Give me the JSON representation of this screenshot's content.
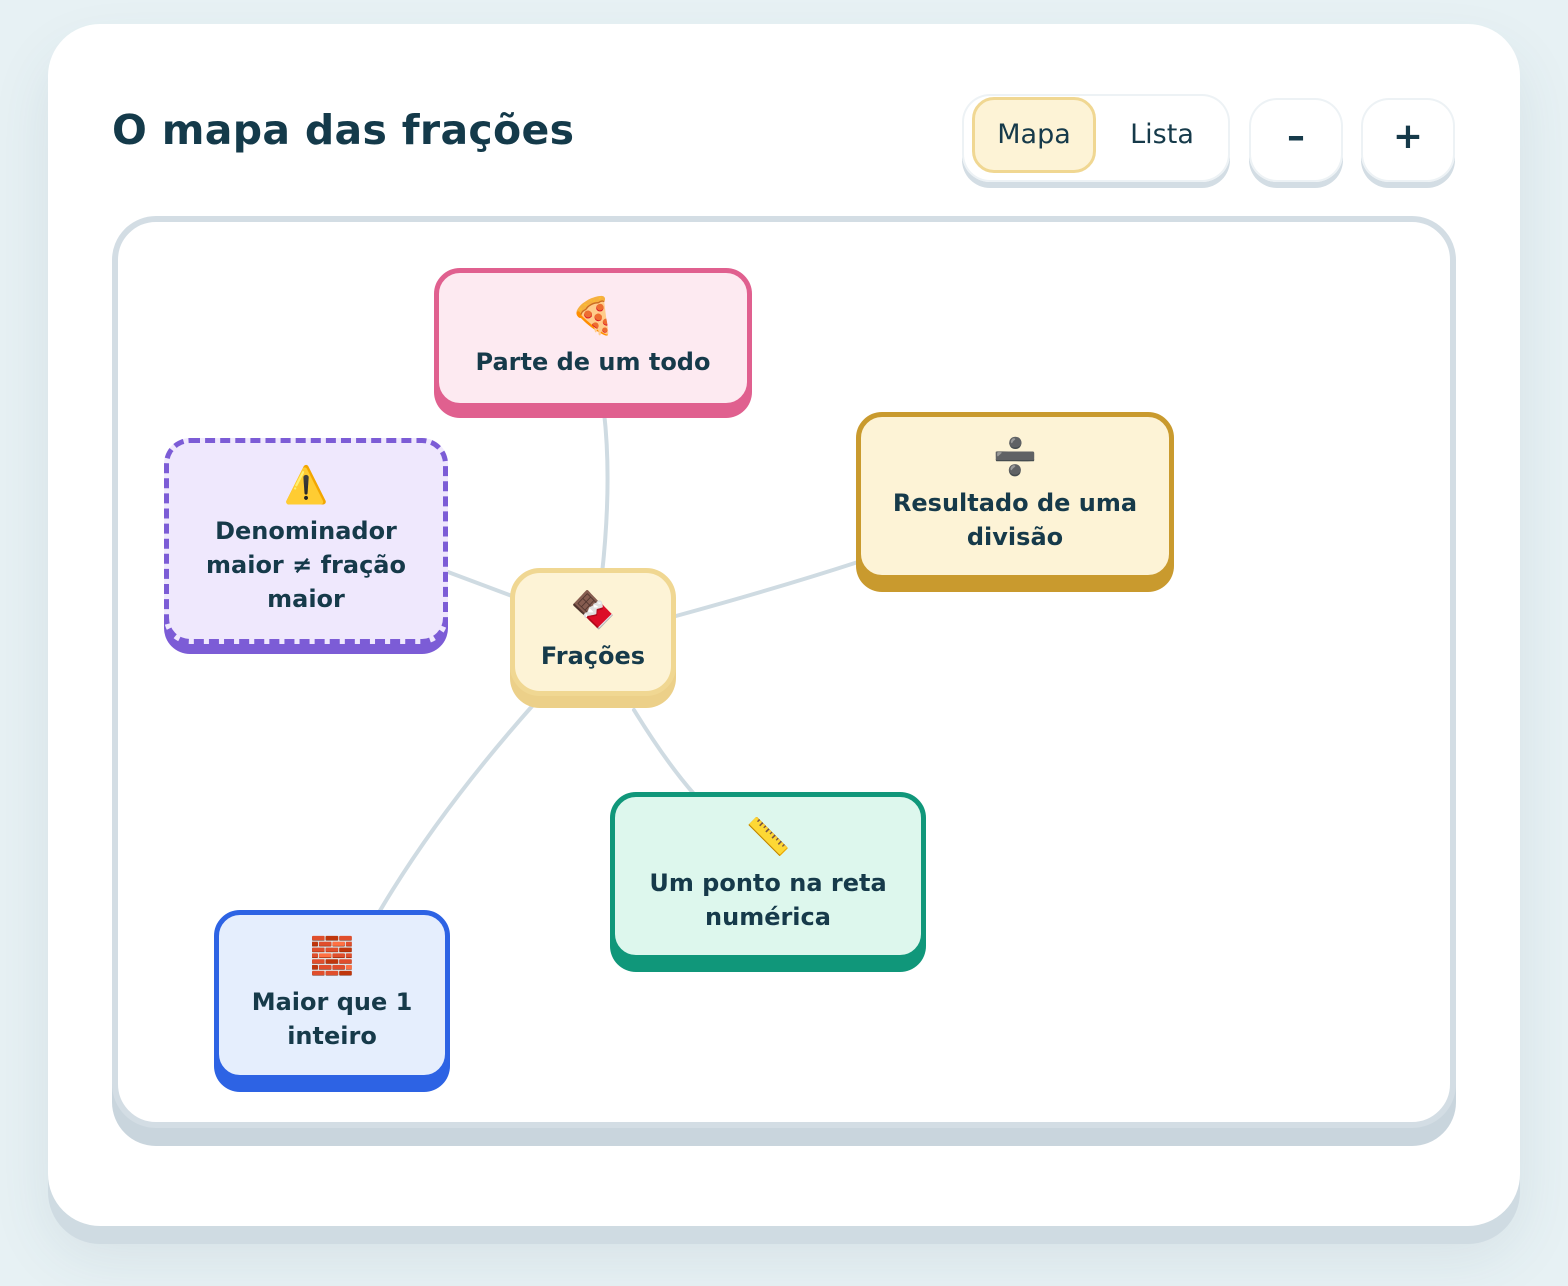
{
  "header": {
    "title": "O mapa das frações"
  },
  "view_toggle": {
    "map_label": "Mapa",
    "list_label": "Lista",
    "selected": "Mapa"
  },
  "zoom": {
    "out_label": "–",
    "in_label": "+"
  },
  "map": {
    "center": {
      "emoji": "🍫",
      "label": "Frações"
    },
    "nodes": {
      "parte": {
        "emoji": "🍕",
        "label": "Parte de um todo"
      },
      "resultado": {
        "emoji": "➗",
        "label": "Resultado de uma divisão"
      },
      "denominador": {
        "emoji": "⚠️",
        "label": "Denominador maior ≠ fração maior"
      },
      "ponto": {
        "emoji": "📏",
        "label": "Um ponto na reta numérica"
      },
      "maior": {
        "emoji": "🧱",
        "label": "Maior que 1 inteiro"
      }
    },
    "link_color": "#cfdbe2"
  },
  "colors": {
    "pink": "#e0608f",
    "gold": "#c99a2e",
    "purple": "#7c5cd6",
    "teal": "#10977a",
    "blue": "#2d63e4",
    "center_border": "#f0d792"
  }
}
